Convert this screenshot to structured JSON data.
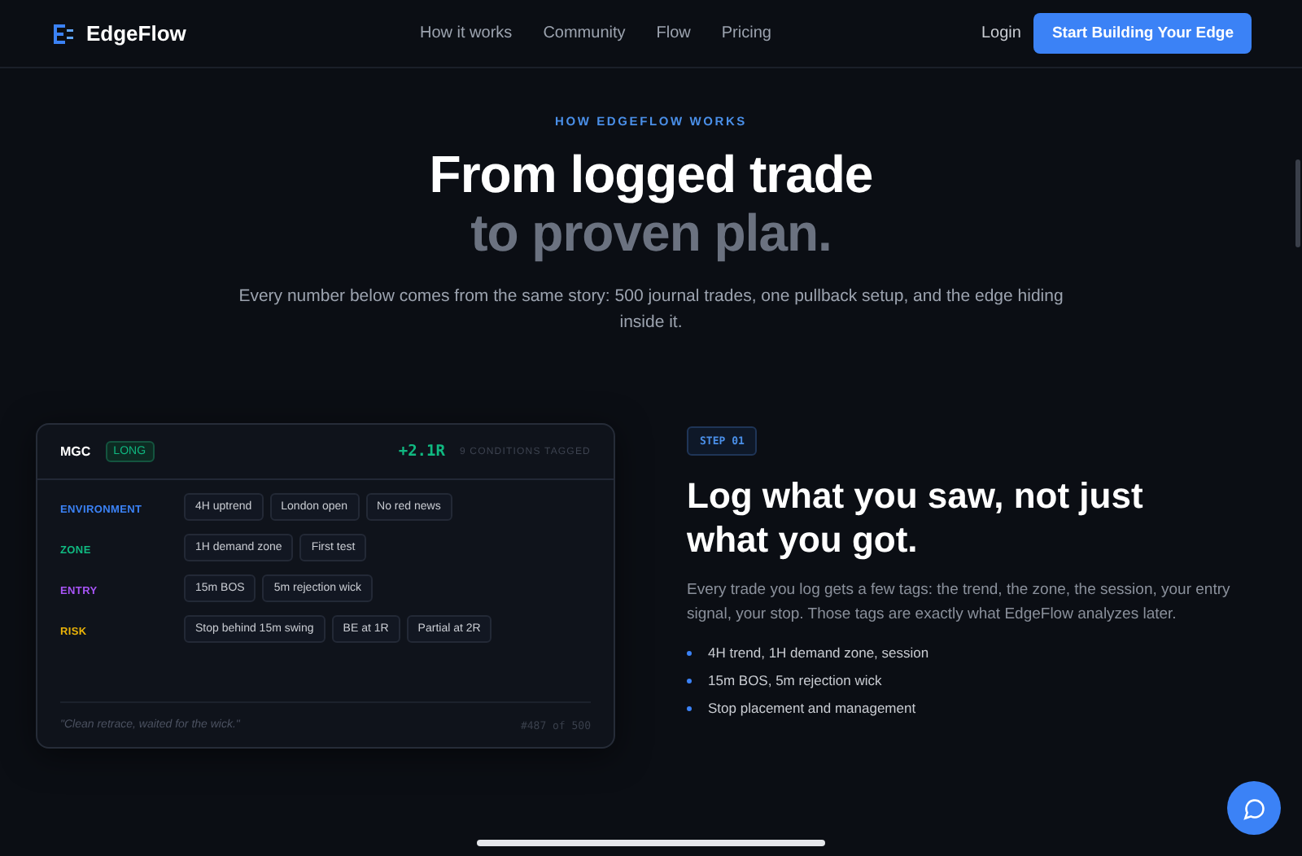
{
  "nav": {
    "brand": "EdgeFlow",
    "links": [
      "How it works",
      "Community",
      "Flow",
      "Pricing"
    ],
    "login": "Login",
    "cta": "Start Building Your Edge"
  },
  "hero": {
    "eyebrow": "HOW EDGEFLOW WORKS",
    "title_line_1": "From logged trade",
    "title_line_2": "to proven plan.",
    "subtitle": "Every number below comes from the same story: 500 journal trades, one pullback setup, and the edge hiding inside it."
  },
  "trade_card": {
    "symbol": "MGC",
    "direction": "LONG",
    "result": "+2.1R",
    "conditions": "9 CONDITIONS TAGGED",
    "categories": [
      {
        "label": "ENVIRONMENT",
        "color": "#3b82f6",
        "tags": [
          "4H uptrend",
          "London open",
          "No red news"
        ]
      },
      {
        "label": "ZONE",
        "color": "#10b981",
        "tags": [
          "1H demand zone",
          "First test"
        ]
      },
      {
        "label": "ENTRY",
        "color": "#a855f7",
        "tags": [
          "15m BOS",
          "5m rejection wick"
        ]
      },
      {
        "label": "RISK",
        "color": "#eab308",
        "tags": [
          "Stop behind 15m swing",
          "BE at 1R",
          "Partial at 2R"
        ]
      }
    ],
    "note": "\"Clean retrace, waited for the wick.\"",
    "counter": "#487 of 500"
  },
  "step": {
    "badge": "STEP 01",
    "title": "Log what you saw, not just what you got.",
    "body": "Every trade you log gets a few tags: the trend, the zone, the session, your entry signal, your stop. Those tags are exactly what EdgeFlow analyzes later.",
    "bullets": [
      "4H trend, 1H demand zone, session",
      "15m BOS, 5m rejection wick",
      "Stop placement and management"
    ]
  }
}
